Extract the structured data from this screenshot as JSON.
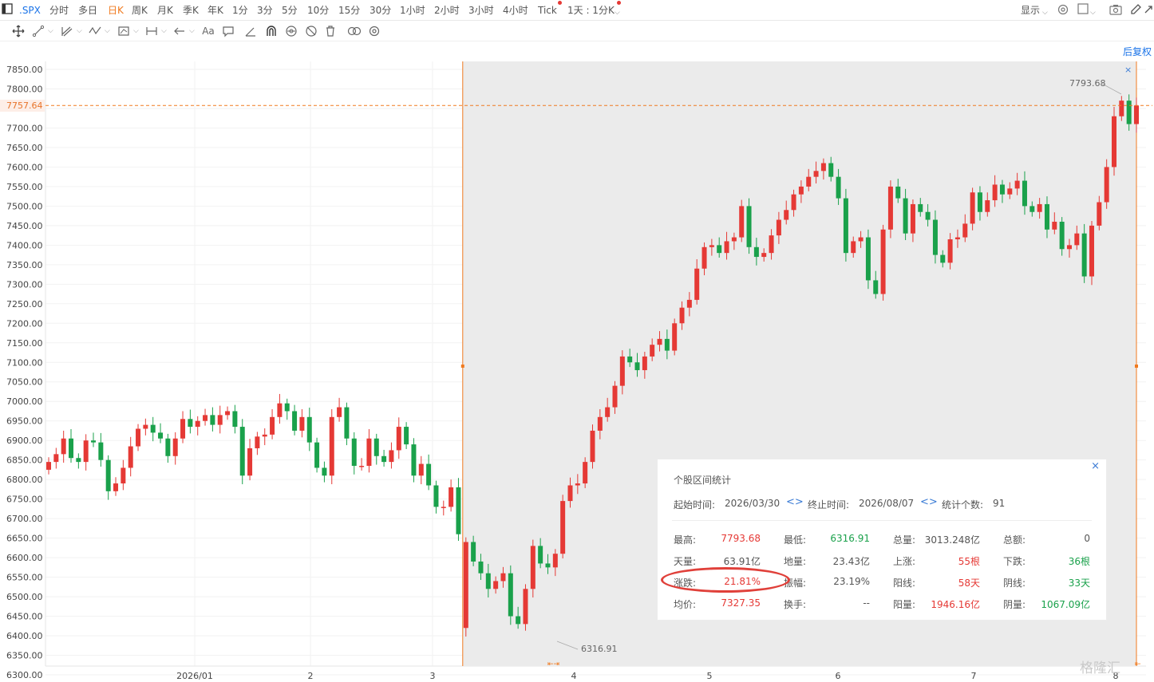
{
  "toolbar": {
    "ticker": ".SPX",
    "periods": [
      "分时",
      "多日",
      "日K",
      "周K",
      "月K",
      "季K",
      "年K",
      "1分",
      "3分",
      "5分",
      "10分",
      "15分",
      "30分",
      "1小时",
      "2小时",
      "3小时",
      "4小时",
      "Tick",
      "1天 : 1分K"
    ],
    "active_period": "日K",
    "display_label": "显示"
  },
  "chart": {
    "adjust_label": "后复权",
    "y_ticks": [
      7850,
      7800,
      7750,
      7700,
      7650,
      7600,
      7550,
      7500,
      7450,
      7400,
      7350,
      7300,
      7250,
      7200,
      7150,
      7100,
      7050,
      7000,
      6950,
      6900,
      6850,
      6800,
      6750,
      6700,
      6650,
      6600,
      6550,
      6500,
      6450,
      6400,
      6350,
      6300
    ],
    "y_tick_labels": [
      "7850.00",
      "7800.00",
      "7750.00",
      "7700.00",
      "7650.00",
      "7600.00",
      "7550.00",
      "7500.00",
      "7450.00",
      "7400.00",
      "7350.00",
      "7300.00",
      "7250.00",
      "7200.00",
      "7150.00",
      "7100.00",
      "7050.00",
      "7000.00",
      "6950.00",
      "6900.00",
      "6850.00",
      "6800.00",
      "6750.00",
      "6700.00",
      "6650.00",
      "6600.00",
      "6550.00",
      "6500.00",
      "6450.00",
      "6400.00",
      "6350.00",
      "6300.00"
    ],
    "current_price": "7757.64",
    "x_labels": [
      "2026/01",
      "2",
      "3",
      "4",
      "5",
      "6",
      "7",
      "8"
    ],
    "high_marker": "7793.68",
    "low_marker": "6316.91",
    "colors": {
      "up": "#e53935",
      "down": "#1aa14b",
      "accent": "#f07a1f",
      "link": "#1a73e8"
    }
  },
  "chart_data": {
    "type": "candlestick",
    "ylim": [
      6280,
      7870
    ],
    "x_axis": [
      "2026/01",
      "2",
      "3",
      "4",
      "5",
      "6",
      "7",
      "8"
    ],
    "range_high": 7793.68,
    "range_low": 6316.91,
    "last_price": 7757.64,
    "closes": [
      6845,
      6865,
      6905,
      6855,
      6845,
      6900,
      6895,
      6850,
      6770,
      6790,
      6830,
      6885,
      6930,
      6940,
      6920,
      6905,
      6860,
      6905,
      6955,
      6935,
      6950,
      6965,
      6940,
      6965,
      6975,
      6935,
      6810,
      6880,
      6910,
      6915,
      6960,
      6995,
      6975,
      6925,
      6960,
      6895,
      6830,
      6810,
      6960,
      6985,
      6905,
      6835,
      6835,
      6905,
      6860,
      6845,
      6875,
      6935,
      6890,
      6810,
      6840,
      6785,
      6730,
      6730,
      6780,
      6660,
      6640,
      6590,
      6560,
      6520,
      6540,
      6560,
      6450,
      6430,
      6520,
      6630,
      6585,
      6575,
      6610,
      6745,
      6785,
      6790,
      6845,
      6925,
      6960,
      6985,
      7040,
      7115,
      7100,
      7080,
      7115,
      7145,
      7160,
      7130,
      7200,
      7240,
      7260,
      7340,
      7395,
      7400,
      7380,
      7410,
      7420,
      7500,
      7395,
      7370,
      7380,
      7425,
      7465,
      7490,
      7530,
      7550,
      7575,
      7590,
      7610,
      7575,
      7520,
      7380,
      7410,
      7420,
      7310,
      7275,
      7440,
      7550,
      7520,
      7430,
      7505,
      7485,
      7465,
      7375,
      7355,
      7415,
      7420,
      7455,
      7535,
      7485,
      7515,
      7555,
      7530,
      7545,
      7565,
      7500,
      7485,
      7505,
      7440,
      7460,
      7390,
      7400,
      7430,
      7320,
      7450,
      7510,
      7600,
      7730,
      7770,
      7710,
      7757.64
    ]
  },
  "stats": {
    "title": "个股区间统计",
    "start_label": "起始时间:",
    "start_value": "2026/03/30",
    "end_label": "终止时间:",
    "end_value": "2026/08/07",
    "count_label": "统计个数:",
    "count_value": "91",
    "rows": [
      [
        {
          "l": "最高:",
          "v": "7793.68",
          "c": "red"
        },
        {
          "l": "最低:",
          "v": "6316.91",
          "c": "green"
        },
        {
          "l": "总量:",
          "v": "3013.248亿",
          "c": "gray"
        },
        {
          "l": "总额:",
          "v": "0",
          "c": "gray"
        }
      ],
      [
        {
          "l": "天量:",
          "v": "63.91亿",
          "c": "gray"
        },
        {
          "l": "地量:",
          "v": "23.43亿",
          "c": "gray"
        },
        {
          "l": "上涨:",
          "v": "55根",
          "c": "red"
        },
        {
          "l": "下跌:",
          "v": "36根",
          "c": "green"
        }
      ],
      [
        {
          "l": "涨跌:",
          "v": "21.81%",
          "c": "red"
        },
        {
          "l": "振幅:",
          "v": "23.19%",
          "c": "gray"
        },
        {
          "l": "阳线:",
          "v": "58天",
          "c": "red"
        },
        {
          "l": "阴线:",
          "v": "33天",
          "c": "green"
        }
      ],
      [
        {
          "l": "均价:",
          "v": "7327.35",
          "c": "red"
        },
        {
          "l": "换手:",
          "v": "--",
          "c": "gray"
        },
        {
          "l": "阳量:",
          "v": "1946.16亿",
          "c": "red"
        },
        {
          "l": "阴量:",
          "v": "1067.09亿",
          "c": "green"
        }
      ]
    ]
  },
  "watermark": "格隆汇"
}
